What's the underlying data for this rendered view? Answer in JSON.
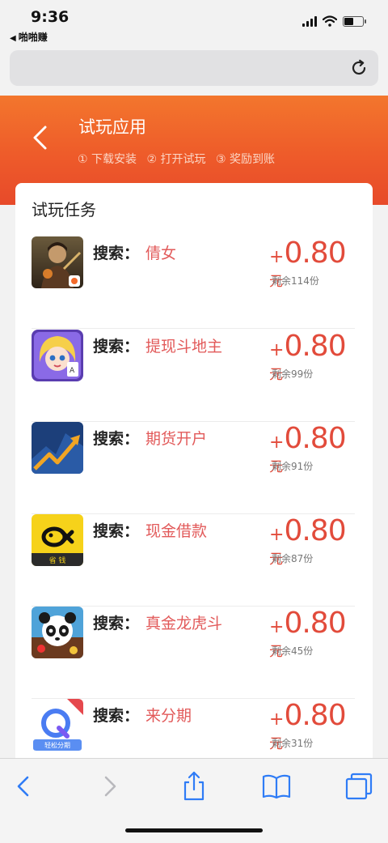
{
  "status_bar": {
    "time": "9:36",
    "back_app": "啪啪赚"
  },
  "header": {
    "title": "试玩应用",
    "steps": [
      "① 下载安装",
      "② 打开试玩",
      "③ 奖励到账"
    ]
  },
  "card": {
    "title": "试玩任务",
    "search_prefix": "搜索：",
    "tasks": [
      {
        "term": "倩女",
        "plus": "+",
        "amount": "0.80",
        "unit": "元",
        "remaining": "剩余114份",
        "icon": "game-warrior-icon"
      },
      {
        "term": "提现斗地主",
        "plus": "+",
        "amount": "0.80",
        "unit": "元",
        "remaining": "剩余99份",
        "icon": "card-game-girl-icon"
      },
      {
        "term": "期货开户",
        "plus": "+",
        "amount": "0.80",
        "unit": "元",
        "remaining": "剩余91份",
        "icon": "trend-chart-icon"
      },
      {
        "term": "现金借款",
        "plus": "+",
        "amount": "0.80",
        "unit": "元",
        "remaining": "剩余87份",
        "icon": "fish-money-icon",
        "icon_text": "省 钱"
      },
      {
        "term": "真金龙虎斗",
        "plus": "+",
        "amount": "0.80",
        "unit": "元",
        "remaining": "剩余45份",
        "icon": "panda-game-icon"
      },
      {
        "term": "来分期",
        "plus": "+",
        "amount": "0.80",
        "unit": "元",
        "remaining": "剩余31份",
        "icon": "q-installment-icon",
        "icon_text": "轻松分期"
      }
    ]
  },
  "colors": {
    "header_orange": "#ee5b2a",
    "reward_red": "#e24b3b",
    "term_red": "#e25a5a",
    "ios_blue": "#2f7cf6"
  }
}
